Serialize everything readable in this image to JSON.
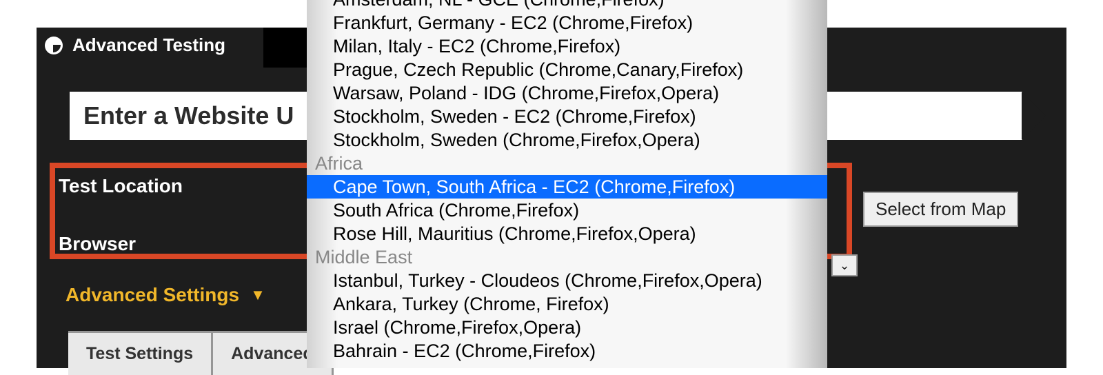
{
  "header": {
    "tab_label": "Advanced Testing"
  },
  "url": {
    "label": "Enter a Website U"
  },
  "fields": {
    "location_label": "Test Location",
    "browser_label": "Browser"
  },
  "advanced": {
    "label": "Advanced Settings"
  },
  "tabs": [
    "Test Settings",
    "Advanced"
  ],
  "buttons": {
    "map": "Select from Map"
  },
  "dropdown": {
    "items": [
      {
        "type": "item",
        "label": "Amsterdam, NL - GCE (Chrome,Firefox)"
      },
      {
        "type": "item",
        "label": "Frankfurt, Germany - EC2 (Chrome,Firefox)"
      },
      {
        "type": "item",
        "label": "Milan, Italy - EC2 (Chrome,Firefox)"
      },
      {
        "type": "item",
        "label": "Prague, Czech Republic (Chrome,Canary,Firefox)"
      },
      {
        "type": "item",
        "label": "Warsaw, Poland - IDG (Chrome,Firefox,Opera)"
      },
      {
        "type": "item",
        "label": "Stockholm, Sweden - EC2 (Chrome,Firefox)"
      },
      {
        "type": "item",
        "label": "Stockholm, Sweden (Chrome,Firefox,Opera)"
      },
      {
        "type": "group",
        "label": "Africa"
      },
      {
        "type": "item",
        "label": "Cape Town, South Africa - EC2 (Chrome,Firefox)",
        "selected": true
      },
      {
        "type": "item",
        "label": "South Africa (Chrome,Firefox)"
      },
      {
        "type": "item",
        "label": "Rose Hill, Mauritius (Chrome,Firefox,Opera)"
      },
      {
        "type": "group",
        "label": "Middle East"
      },
      {
        "type": "item",
        "label": "Istanbul, Turkey - Cloudeos (Chrome,Firefox,Opera)"
      },
      {
        "type": "item",
        "label": "Ankara, Turkey (Chrome, Firefox)"
      },
      {
        "type": "item",
        "label": "Israel (Chrome,Firefox,Opera)"
      },
      {
        "type": "item",
        "label": "Bahrain - EC2 (Chrome,Firefox)"
      }
    ]
  }
}
